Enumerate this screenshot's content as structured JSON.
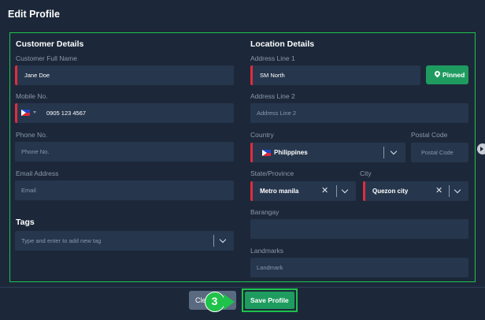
{
  "page": {
    "title": "Edit Profile"
  },
  "customer": {
    "section_title": "Customer Details",
    "full_name": {
      "label": "Customer Full Name",
      "value": "Jane Doe"
    },
    "mobile": {
      "label": "Mobile No.",
      "value": "0905 123 4567",
      "country_flag": "philippines-flag"
    },
    "phone": {
      "label": "Phone No.",
      "placeholder": "Phone No."
    },
    "email": {
      "label": "Email Address",
      "placeholder": "Email"
    },
    "tags": {
      "section_title": "Tags",
      "placeholder": "Type and enter to add new tag"
    }
  },
  "location": {
    "section_title": "Location Details",
    "address1": {
      "label": "Address Line 1",
      "value": "SM North"
    },
    "pinned_button": {
      "label": "Pinned",
      "icon": "map-pin-icon"
    },
    "address2": {
      "label": "Address Line 2",
      "placeholder": "Address Line 2"
    },
    "country": {
      "label": "Country",
      "value": "Philippines"
    },
    "postal": {
      "label": "Postal Code",
      "placeholder": "Postal Code"
    },
    "province": {
      "label": "State/Province",
      "value": "Metro manila"
    },
    "city": {
      "label": "City",
      "value": "Quezon city"
    },
    "barangay": {
      "label": "Barangay"
    },
    "landmarks": {
      "label": "Landmarks",
      "placeholder": "Landmark"
    }
  },
  "footer": {
    "clear_label": "Cle",
    "save_label": "Save Profile",
    "step_number": "3"
  },
  "colors": {
    "background": "#1c283a",
    "field": "#26364d",
    "accent_green": "#1e9c5f",
    "highlight_green": "#1ec24a",
    "required_red": "#e02d3c"
  }
}
